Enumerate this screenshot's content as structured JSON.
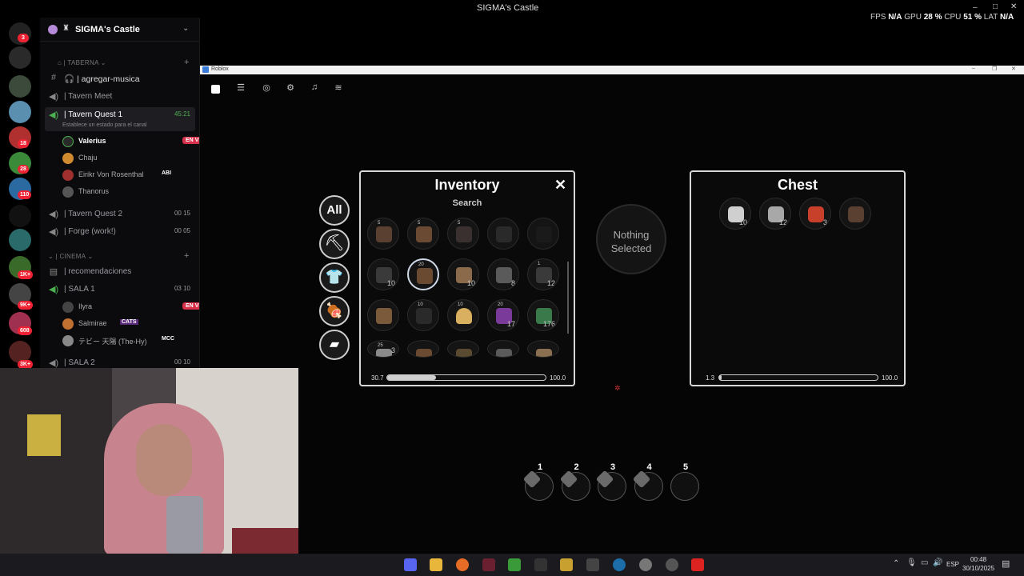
{
  "top": {
    "window_title": "SIGMA's Castle",
    "stats": {
      "fps_label": "FPS",
      "fps": "N/A",
      "gpu_label": "GPU",
      "gpu": "28 %",
      "cpu_label": "CPU",
      "cpu": "51 %",
      "lat_label": "LAT",
      "lat": "N/A"
    }
  },
  "rail_badges": [
    "3",
    "18",
    "28",
    "110",
    "1K+",
    "9K+",
    "608",
    "3K+"
  ],
  "server": {
    "name": "SIGMA's Castle"
  },
  "channels": {
    "cat_taberna": "TABERNA",
    "agregar_musica": "agregar-musica",
    "tavern_meet": "| Tavern Meet",
    "tavern_quest_1": "| Tavern Quest 1",
    "tavern_quest_1_time": "45:21",
    "tavern_quest_1_status": "Establece un estado para el canal",
    "users_quest1": [
      {
        "name": "Valerius",
        "live": "EN VIVO"
      },
      {
        "name": "Chaju"
      },
      {
        "name": "Eirikr Von Rosenthal",
        "tag": "ABI"
      },
      {
        "name": "Thanorus"
      }
    ],
    "tavern_quest_2": "| Tavern Quest 2",
    "tavern_quest_2_time": "00 15",
    "forge": "| Forge (work!)",
    "forge_time": "00 05",
    "cat_cinema": "CINEMA",
    "recomendaciones": "| recomendaciones",
    "sala1": "| SALA 1",
    "sala1_time": "03 10",
    "users_sala1": [
      {
        "name": "Ilyra",
        "live": "EN VIVO"
      },
      {
        "name": "Salmirae",
        "tag": "CATS"
      },
      {
        "name": "テビー 天陽 (The-Hy)",
        "tag": "MCC"
      }
    ],
    "sala2": "| SALA 2",
    "sala2_time": "00 10"
  },
  "roblox": {
    "window_label": "Roblox"
  },
  "inventory": {
    "title": "Inventory",
    "search_label": "Search",
    "close": "✕",
    "all_label": "All",
    "rows": [
      [
        {
          "q": "",
          "ql": "5"
        },
        {
          "q": "",
          "ql": "5"
        },
        {
          "q": "",
          "ql": "5"
        },
        {
          "q": "",
          "ql": ""
        },
        {
          "q": "",
          "ql": ""
        }
      ],
      [
        {
          "q": "10",
          "ql": ""
        },
        {
          "q": "",
          "ql": "20"
        },
        {
          "q": "10",
          "ql": ""
        },
        {
          "q": "8",
          "ql": ""
        },
        {
          "q": "12",
          "ql": "1"
        }
      ],
      [
        {
          "q": "",
          "ql": ""
        },
        {
          "q": "",
          "ql": "10"
        },
        {
          "q": "",
          "ql": "10"
        },
        {
          "q": "17",
          "ql": "20"
        },
        {
          "q": "176",
          "ql": ""
        }
      ],
      [
        {
          "q": "3",
          "ql": "25"
        },
        {
          "q": "",
          "ql": ""
        },
        {
          "q": "",
          "ql": ""
        },
        {
          "q": "",
          "ql": ""
        },
        {
          "q": "",
          "ql": ""
        }
      ]
    ],
    "weight": 30.7,
    "max": "100.0",
    "weight_label": "30.7"
  },
  "nothing_selected": "Nothing Selected",
  "chest": {
    "title": "Chest",
    "items": [
      {
        "q": "10"
      },
      {
        "q": "12"
      },
      {
        "q": "3"
      },
      {
        "q": ""
      }
    ],
    "weight": 1.3,
    "weight_label": "1.3",
    "max": "100.0"
  },
  "hotbar": [
    "1",
    "2",
    "3",
    "4",
    "5"
  ],
  "taskbar": {
    "lang": "ESP",
    "time": "00:48",
    "date": "30/10/2025"
  }
}
